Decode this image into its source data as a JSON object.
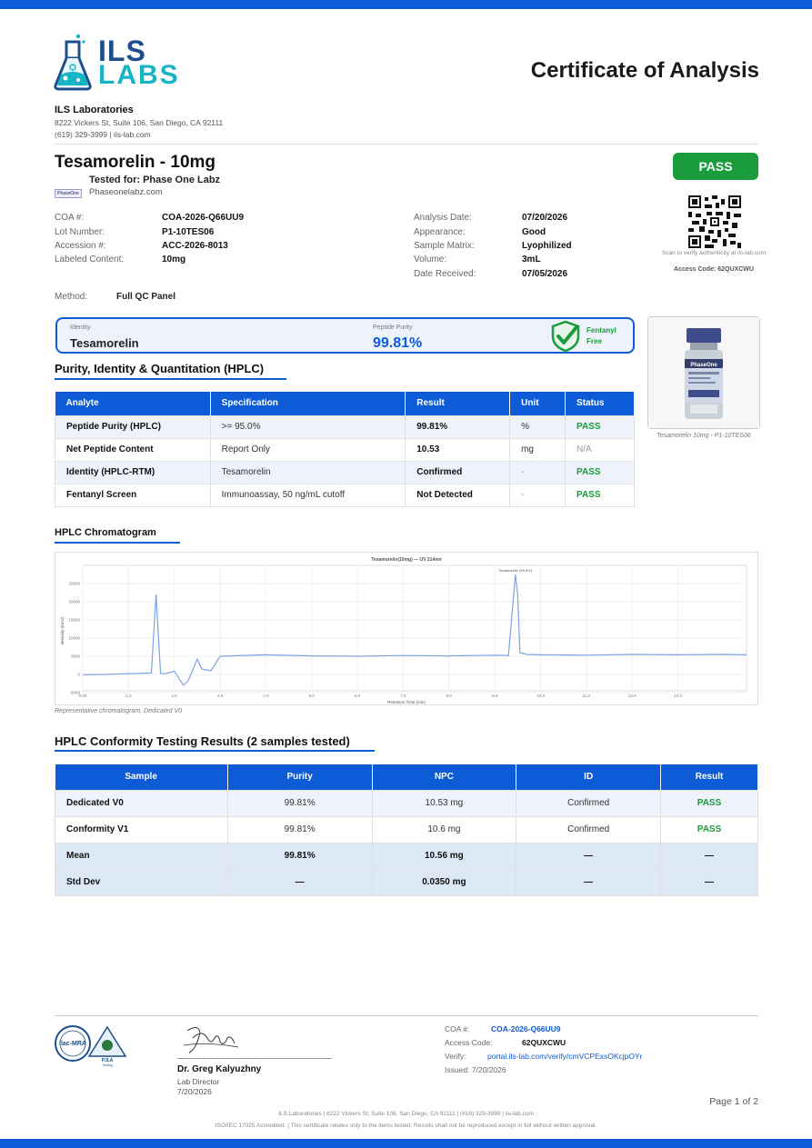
{
  "brand": {
    "logo_top": "ILS",
    "logo_bottom": "LABS",
    "primary": "#0d5bd7",
    "pass_color": "#1a9b3c"
  },
  "header": {
    "title": "Certificate of Analysis",
    "lab_name": "ILS Laboratories",
    "address": "8222 Vickers St, Suite 106, San Diego, CA 92111",
    "contact": "(619) 329-3999  |  ils-lab.com"
  },
  "product": {
    "name": "Tesamorelin - 10mg",
    "tested_for": "Tested for: Phase One Labz",
    "client_site": "Phaseonelabz.com",
    "client_logo": "PhaseOne",
    "overall_result": "PASS"
  },
  "verify": {
    "scan_caption": "Scan to verify authenticity at ils-lab.com",
    "access_code_label": "Access Code: 62QUXCWU"
  },
  "details_left": [
    {
      "label": "COA #:",
      "value": "COA-2026-Q66UU9"
    },
    {
      "label": "Lot Number:",
      "value": "P1-10TES06"
    },
    {
      "label": "Accession #:",
      "value": "ACC-2026-8013"
    },
    {
      "label": "Labeled Content:",
      "value": "10mg"
    }
  ],
  "details_right": [
    {
      "label": "Analysis Date:",
      "value": "07/20/2026"
    },
    {
      "label": "Appearance:",
      "value": "Good"
    },
    {
      "label": "Sample Matrix:",
      "value": "Lyophilized"
    },
    {
      "label": "Volume:",
      "value": "3mL"
    },
    {
      "label": "Date Received:",
      "value": "07/05/2026"
    }
  ],
  "method": {
    "label": "Method:",
    "value": "Full QC Panel"
  },
  "summary": {
    "identity_label": "Identity",
    "identity_value": "Tesamorelin",
    "purity_label": "Peptide Purity",
    "purity_value": "99.81%",
    "fentanyl_line1": "Fentanyl",
    "fentanyl_line2": "Free"
  },
  "vial": {
    "label": "PhaseOne",
    "caption": "Tesamorelin 10mg - P1-10TES06"
  },
  "purity_section": {
    "title": "Purity, Identity & Quantitation (HPLC)",
    "headers": [
      "Analyte",
      "Specification",
      "Result",
      "Unit",
      "Status"
    ],
    "rows": [
      [
        "Peptide Purity (HPLC)",
        ">= 95.0%",
        "99.81%",
        "%",
        "PASS"
      ],
      [
        "Net Peptide Content",
        "Report Only",
        "10.53",
        "mg",
        "N/A"
      ],
      [
        "Identity (HPLC-RTM)",
        "Tesamorelin",
        "Confirmed",
        "-",
        "PASS"
      ],
      [
        "Fentanyl Screen",
        "Immunoassay, 50 ng/mL cutoff",
        "Not Detected",
        "-",
        "PASS"
      ]
    ]
  },
  "chromatogram": {
    "title": "HPLC Chromatogram",
    "caption": "Representative chromatogram, Dedicated V0"
  },
  "chart_data": {
    "type": "line",
    "title": "Tesamorelin(10mg) — UV 214nm",
    "xlabel": "Retention Time (min)",
    "ylabel": "Intensity (mAU)",
    "peak_label": "Tesamorelin (99.8%)",
    "x": [
      0,
      0.5,
      1.0,
      1.5,
      1.6,
      1.7,
      1.8,
      2.0,
      2.2,
      2.3,
      2.5,
      2.6,
      2.8,
      3.0,
      4.0,
      5.0,
      6.0,
      7.0,
      8.0,
      9.0,
      9.3,
      9.45,
      9.5,
      9.55,
      9.7,
      10.0,
      11.0,
      12.0,
      13.0,
      14.0,
      14.5
    ],
    "y": [
      -100,
      0,
      200,
      400,
      22000,
      300,
      200,
      900,
      -3000,
      -1800,
      4200,
      1500,
      1000,
      5000,
      5400,
      5100,
      5000,
      5200,
      5100,
      5300,
      5200,
      27500,
      22000,
      6000,
      5500,
      5400,
      5300,
      5500,
      5400,
      5500,
      5400
    ],
    "xlim": [
      0,
      14.5
    ],
    "ylim": [
      -4500,
      30000
    ],
    "xticks": [
      "0.00",
      "1.0",
      "2.0",
      "3.0",
      "4.0",
      "5.0",
      "6.0",
      "7.0",
      "8.0",
      "9.0",
      "10.0",
      "11.0",
      "12.0",
      "13.0"
    ],
    "yticks": [
      "-5000",
      "0",
      "5000",
      "10000",
      "15000",
      "20000",
      "25000"
    ],
    "grid": true
  },
  "conformity": {
    "title": "HPLC Conformity Testing Results (2 samples tested)",
    "headers": [
      "Sample",
      "Purity",
      "NPC",
      "ID",
      "Result"
    ],
    "rows": [
      [
        "Dedicated V0",
        "99.81%",
        "10.53 mg",
        "Confirmed",
        "PASS"
      ],
      [
        "Conformity V1",
        "99.81%",
        "10.6 mg",
        "Confirmed",
        "PASS"
      ]
    ],
    "summary_rows": [
      [
        "Mean",
        "99.81%",
        "10.56 mg",
        "—",
        "—"
      ],
      [
        "Std Dev",
        "—",
        "0.0350 mg",
        "—",
        "—"
      ]
    ]
  },
  "footer": {
    "accred_1": "ilac-MRA",
    "accred_2": "PJLA",
    "accred_2_sub": "Testing",
    "signer_name": "Dr. Greg Kalyuzhny",
    "signer_title": "Lab Director",
    "signer_date": "7/20/2026",
    "coa_label": "COA #:",
    "coa_value": "COA-2026-Q66UU9",
    "access_label": "Access Code:",
    "access_value": "62QUXCWU",
    "verify_label": "Verify:",
    "verify_value": "portal.ils-lab.com/verify/cmVCPExsOKcjpOYr",
    "issued": "Issued: 7/20/2026",
    "page": "Page 1 of 2",
    "line1": "ILS Laboratories  |  8222 Vickers St, Suite 106, San Diego, CA 92111  |  (619) 329-3999  |  ils-lab.com",
    "line2": "ISO/IEC 17025 Accredited.  |  This certificate relates only to the items tested. Results shall not be reproduced except in full without written approval."
  }
}
